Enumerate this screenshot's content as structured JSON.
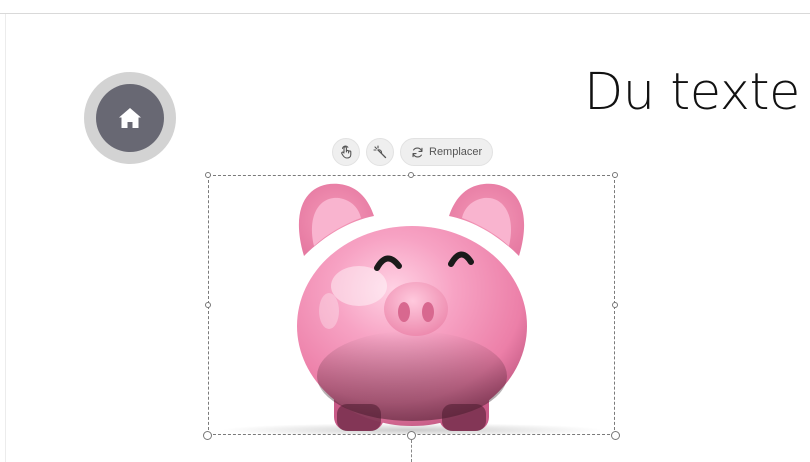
{
  "page": {
    "heading": "Du texte"
  },
  "toolbar": {
    "buttons": [
      {
        "icon": "touch-icon"
      },
      {
        "icon": "magic-wand-icon"
      },
      {
        "icon": "refresh-icon",
        "label": "Remplacer"
      }
    ]
  },
  "colors": {
    "home_outer": "#d3d3d3",
    "home_inner": "#686873",
    "pig_body": "#f48bb2",
    "selection_border": "#7a7a7a"
  }
}
